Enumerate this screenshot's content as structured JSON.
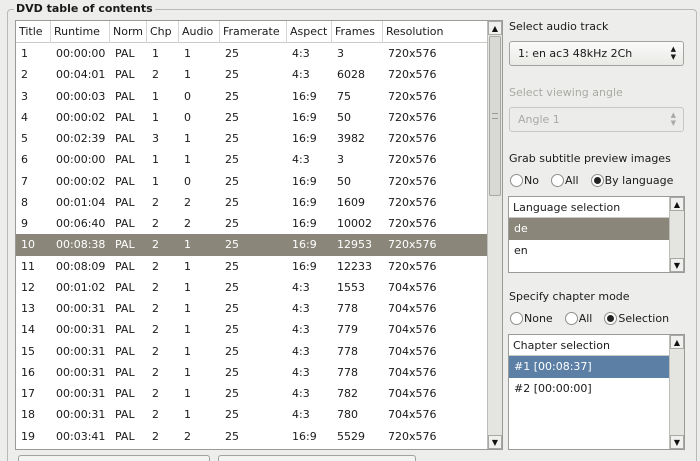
{
  "group": {
    "title": "DVD table of contents"
  },
  "table": {
    "columns": [
      "Title",
      "Runtime",
      "Norm",
      "Chp",
      "Audio",
      "Framerate",
      "Aspect",
      "Frames",
      "Resolution"
    ],
    "rows": [
      [
        "1",
        "00:00:00",
        "PAL",
        "1",
        "1",
        "25",
        "4:3",
        "3",
        "720x576"
      ],
      [
        "2",
        "00:04:01",
        "PAL",
        "2",
        "1",
        "25",
        "4:3",
        "6028",
        "720x576"
      ],
      [
        "3",
        "00:00:03",
        "PAL",
        "1",
        "0",
        "25",
        "16:9",
        "75",
        "720x576"
      ],
      [
        "4",
        "00:00:02",
        "PAL",
        "1",
        "0",
        "25",
        "16:9",
        "50",
        "720x576"
      ],
      [
        "5",
        "00:02:39",
        "PAL",
        "3",
        "1",
        "25",
        "16:9",
        "3982",
        "720x576"
      ],
      [
        "6",
        "00:00:00",
        "PAL",
        "1",
        "1",
        "25",
        "4:3",
        "3",
        "720x576"
      ],
      [
        "7",
        "00:00:02",
        "PAL",
        "1",
        "0",
        "25",
        "16:9",
        "50",
        "720x576"
      ],
      [
        "8",
        "00:01:04",
        "PAL",
        "2",
        "2",
        "25",
        "16:9",
        "1609",
        "720x576"
      ],
      [
        "9",
        "00:06:40",
        "PAL",
        "2",
        "2",
        "25",
        "16:9",
        "10002",
        "720x576"
      ],
      [
        "10",
        "00:08:38",
        "PAL",
        "2",
        "1",
        "25",
        "16:9",
        "12953",
        "720x576"
      ],
      [
        "11",
        "00:08:09",
        "PAL",
        "2",
        "1",
        "25",
        "16:9",
        "12233",
        "720x576"
      ],
      [
        "12",
        "00:01:02",
        "PAL",
        "2",
        "1",
        "25",
        "4:3",
        "1553",
        "704x576"
      ],
      [
        "13",
        "00:00:31",
        "PAL",
        "2",
        "1",
        "25",
        "4:3",
        "778",
        "704x576"
      ],
      [
        "14",
        "00:00:31",
        "PAL",
        "2",
        "1",
        "25",
        "4:3",
        "779",
        "704x576"
      ],
      [
        "15",
        "00:00:31",
        "PAL",
        "2",
        "1",
        "25",
        "4:3",
        "778",
        "704x576"
      ],
      [
        "16",
        "00:00:31",
        "PAL",
        "2",
        "1",
        "25",
        "4:3",
        "778",
        "704x576"
      ],
      [
        "17",
        "00:00:31",
        "PAL",
        "2",
        "1",
        "25",
        "4:3",
        "782",
        "704x576"
      ],
      [
        "18",
        "00:00:31",
        "PAL",
        "2",
        "1",
        "25",
        "4:3",
        "780",
        "704x576"
      ],
      [
        "19",
        "00:03:41",
        "PAL",
        "2",
        "2",
        "25",
        "16:9",
        "5529",
        "720x576"
      ]
    ],
    "selected_row": 9
  },
  "audio": {
    "label": "Select audio track",
    "value": "1: en ac3 48kHz 2Ch"
  },
  "angle": {
    "label": "Select viewing angle",
    "value": "Angle 1"
  },
  "subtitle": {
    "label": "Grab subtitle preview images",
    "options": [
      "No",
      "All",
      "By language"
    ],
    "selected": "By language",
    "list_header": "Language selection",
    "languages": [
      "de",
      "en"
    ]
  },
  "chapter": {
    "label": "Specify chapter mode",
    "options": [
      "None",
      "All",
      "Selection"
    ],
    "selected": "Selection",
    "list_header": "Chapter selection",
    "chapters": [
      "#1 [00:08:37]",
      "#2 [00:00:00]"
    ]
  }
}
